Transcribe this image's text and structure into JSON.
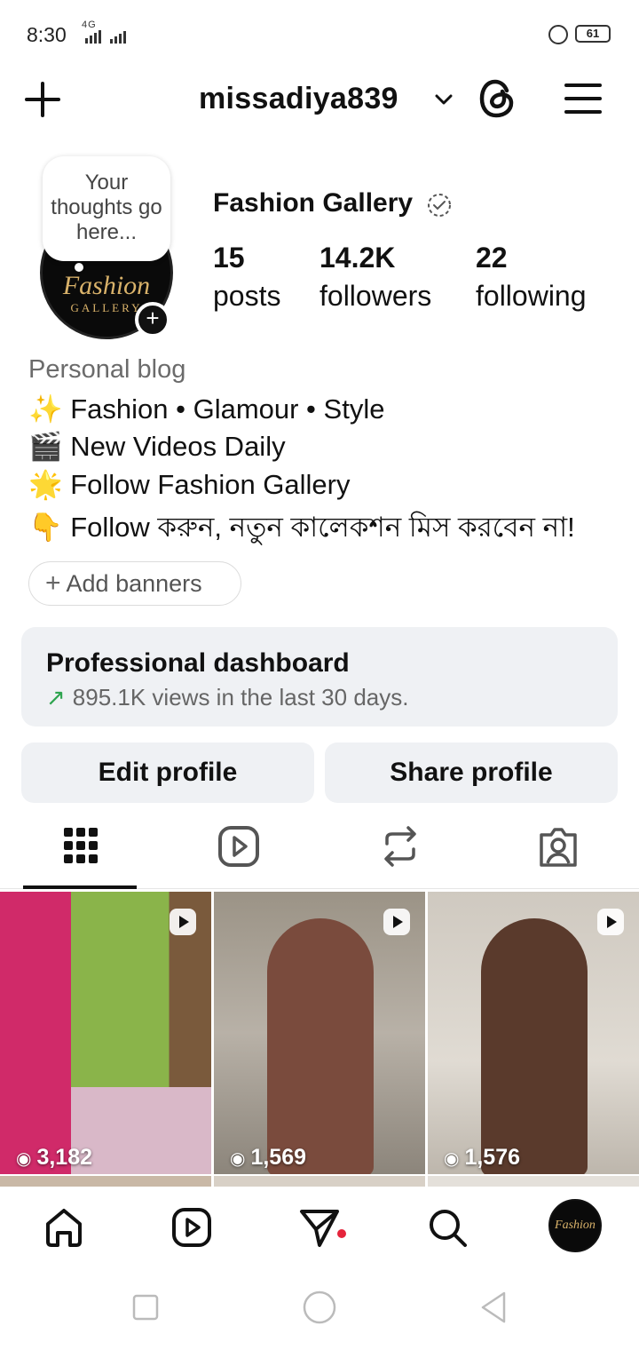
{
  "status_bar": {
    "time": "8:30",
    "network": "4G",
    "battery": "61"
  },
  "top_bar": {
    "username": "missadiya839"
  },
  "profile": {
    "note": "Your thoughts go here...",
    "avatar_text": "Fashion",
    "avatar_subtext": "GALLERY",
    "full_name": "Fashion Gallery",
    "stats": [
      {
        "value": "15",
        "label": "posts"
      },
      {
        "value": "14.2K",
        "label": "followers"
      },
      {
        "value": "22",
        "label": "following"
      }
    ],
    "category": "Personal blog",
    "bio": [
      "✨  Fashion • Glamour • Style",
      "🎬 New  Videos Daily",
      "🌟 Follow Fashion Gallery",
      "👇 Follow করুন, নতুন কালেকশন মিস করবেন না!"
    ],
    "add_banners": "Add banners"
  },
  "dashboard": {
    "title": "Professional dashboard",
    "subtitle": "895.1K views in the last 30 days."
  },
  "buttons": {
    "edit": "Edit profile",
    "share": "Share profile"
  },
  "tabs": [
    {
      "icon": "grid-icon"
    },
    {
      "icon": "reels-icon"
    },
    {
      "icon": "reposts-icon"
    },
    {
      "icon": "tagged-icon"
    }
  ],
  "grid": [
    {
      "views": "3,182",
      "type": "reel"
    },
    {
      "views": "1,569",
      "type": "reel"
    },
    {
      "views": "1,576",
      "type": "reel"
    }
  ],
  "bottom_nav": [
    {
      "icon": "home-icon"
    },
    {
      "icon": "reels-icon"
    },
    {
      "icon": "direct-messages-icon"
    },
    {
      "icon": "search-icon"
    },
    {
      "icon": "profile-avatar"
    }
  ],
  "colors": {
    "accent_green": "#2ea44f",
    "notification_red": "#e5243b",
    "surface": "#eff1f4"
  }
}
